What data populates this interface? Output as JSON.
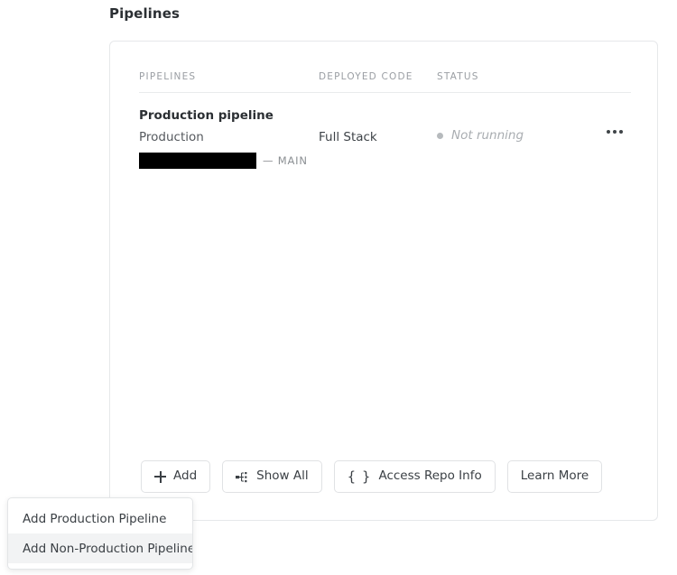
{
  "page": {
    "title": "Pipelines"
  },
  "table": {
    "columns": {
      "pipelines": "PIPELINES",
      "deployed_code": "DEPLOYED CODE",
      "status": "STATUS"
    },
    "rows": [
      {
        "name": "Production pipeline",
        "environment": "Production",
        "deployed_code": "Full Stack",
        "status": "Not running",
        "status_dot_color": "#b6babd",
        "repository_redacted": true,
        "branch": "— MAIN",
        "overflow_menu": "more-options"
      }
    ]
  },
  "toolbar": {
    "buttons": [
      {
        "label": "Add",
        "icon": "plus-icon"
      },
      {
        "label": "Show All",
        "icon": "tree-hierarchy-icon"
      },
      {
        "label": "Access Repo Info",
        "icon": "curly-braces-icon"
      },
      {
        "label": "Learn More",
        "icon": ""
      }
    ]
  },
  "add_menu": {
    "items": [
      {
        "label": "Add Production Pipeline",
        "hovered": false
      },
      {
        "label": "Add Non-Production Pipeline",
        "hovered": true
      }
    ]
  },
  "colors": {
    "card_border": "#e6e8ea",
    "page_background": "#ffffff",
    "text_primary": "#2b2f33",
    "text_muted": "#9a9ea3",
    "status_muted": "#a9adb1",
    "menu_hover": "#f2f3f4",
    "redaction": "#000000"
  }
}
